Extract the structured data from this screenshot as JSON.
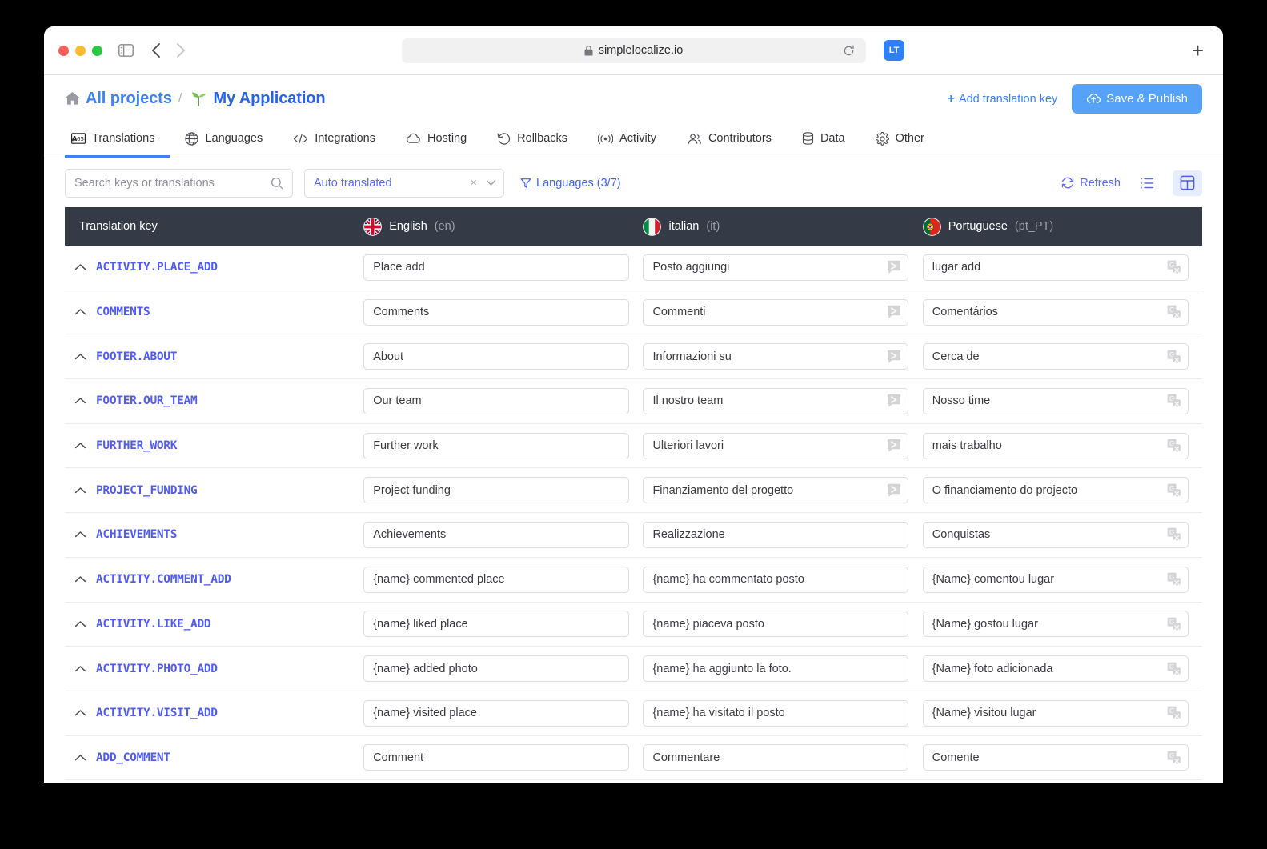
{
  "browser": {
    "url": "simplelocalize.io",
    "lock_icon": "lock-icon",
    "reload_icon": "reload-icon",
    "extension_label": "LT",
    "new_tab_label": "+"
  },
  "header": {
    "breadcrumb_root": "All projects",
    "breadcrumb_sep": "/",
    "breadcrumb_current": "My Application",
    "add_key_label": "Add translation key",
    "add_key_plus": "+",
    "publish_label": "Save & Publish"
  },
  "tabs": [
    {
      "label": "Translations",
      "icon": "translate-icon",
      "active": true
    },
    {
      "label": "Languages",
      "icon": "globe-icon",
      "active": false
    },
    {
      "label": "Integrations",
      "icon": "code-icon",
      "active": false
    },
    {
      "label": "Hosting",
      "icon": "cloud-icon",
      "active": false
    },
    {
      "label": "Rollbacks",
      "icon": "undo-icon",
      "active": false
    },
    {
      "label": "Activity",
      "icon": "broadcast-icon",
      "active": false
    },
    {
      "label": "Contributors",
      "icon": "people-icon",
      "active": false
    },
    {
      "label": "Data",
      "icon": "database-icon",
      "active": false
    },
    {
      "label": "Other",
      "icon": "gear-icon",
      "active": false
    }
  ],
  "toolbar": {
    "search_placeholder": "Search keys or translations",
    "search_value": "",
    "search_icon": "search-icon",
    "filter_value": "Auto translated",
    "filter_clear": "×",
    "languages_filter": "Languages (3/7)",
    "refresh_label": "Refresh",
    "list_view_icon": "list-view-icon",
    "grid_view_icon": "grid-view-icon"
  },
  "table": {
    "key_column_header": "Translation key",
    "languages": [
      {
        "name": "English",
        "code": "(en)",
        "flag": "uk-flag"
      },
      {
        "name": "italian",
        "code": "(it)",
        "flag": "italy-flag"
      },
      {
        "name": "Portuguese",
        "code": "(pt_PT)",
        "flag": "portugal-flag"
      }
    ],
    "rows": [
      {
        "key": "ACTIVITY.PLACE_ADD",
        "en": "Place add",
        "it": "Posto aggiungi",
        "it_badge": "deepl-icon",
        "pt": "lugar add",
        "pt_badge": "google-translate-icon"
      },
      {
        "key": "COMMENTS",
        "en": "Comments",
        "it": "Commenti",
        "it_badge": "deepl-icon",
        "pt": "Comentários",
        "pt_badge": "google-translate-icon"
      },
      {
        "key": "FOOTER.ABOUT",
        "en": "About",
        "it": "Informazioni su",
        "it_badge": "deepl-icon",
        "pt": "Cerca de",
        "pt_badge": "google-translate-icon"
      },
      {
        "key": "FOOTER.OUR_TEAM",
        "en": "Our team",
        "it": "Il nostro team",
        "it_badge": "deepl-icon",
        "pt": "Nosso time",
        "pt_badge": "google-translate-icon"
      },
      {
        "key": "FURTHER_WORK",
        "en": "Further work",
        "it": "Ulteriori lavori",
        "it_badge": "deepl-icon",
        "pt": "mais trabalho",
        "pt_badge": "google-translate-icon"
      },
      {
        "key": "PROJECT_FUNDING",
        "en": "Project funding",
        "it": "Finanziamento del progetto",
        "it_badge": "deepl-icon",
        "pt": "O financiamento do projecto",
        "pt_badge": "google-translate-icon"
      },
      {
        "key": "ACHIEVEMENTS",
        "en": "Achievements",
        "it": "Realizzazione",
        "it_badge": "",
        "pt": "Conquistas",
        "pt_badge": "google-translate-icon"
      },
      {
        "key": "ACTIVITY.COMMENT_ADD",
        "en": "{name} commented place",
        "it": "{name} ha commentato posto",
        "it_badge": "",
        "pt": "{Name} comentou lugar",
        "pt_badge": "google-translate-icon"
      },
      {
        "key": "ACTIVITY.LIKE_ADD",
        "en": "{name} liked place",
        "it": "{name} piaceva posto",
        "it_badge": "",
        "pt": "{Name} gostou lugar",
        "pt_badge": "google-translate-icon"
      },
      {
        "key": "ACTIVITY.PHOTO_ADD",
        "en": "{name} added photo",
        "it": "{name} ha aggiunto la foto.",
        "it_badge": "",
        "pt": "{Name} foto adicionada",
        "pt_badge": "google-translate-icon"
      },
      {
        "key": "ACTIVITY.VISIT_ADD",
        "en": "{name} visited place",
        "it": "{name} ha visitato il posto",
        "it_badge": "",
        "pt": "{Name} visitou lugar",
        "pt_badge": "google-translate-icon"
      },
      {
        "key": "ADD_COMMENT",
        "en": "Comment",
        "it": "Commentare",
        "it_badge": "",
        "pt": "Comente",
        "pt_badge": "google-translate-icon"
      }
    ]
  },
  "colors": {
    "accent_blue": "#3b82f6",
    "key_purple": "#4f5bf2",
    "header_dark": "#343a46",
    "publish_button": "#55a2f7"
  }
}
